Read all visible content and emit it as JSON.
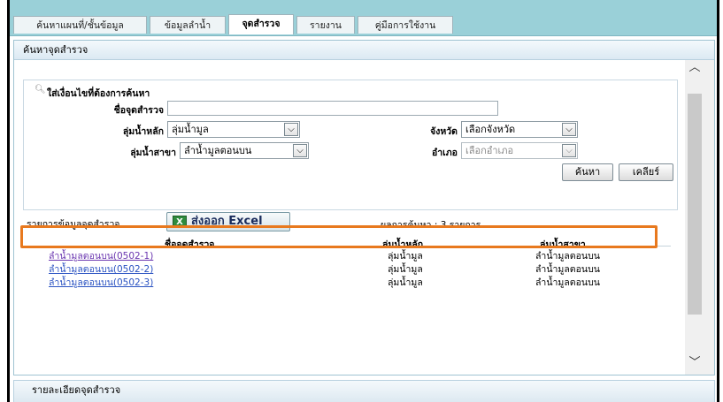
{
  "tabs": [
    {
      "label": "ค้นหาแผนที่/ชั้นข้อมูล"
    },
    {
      "label": "ข้อมูลลำน้ำ"
    },
    {
      "label": "จุดสำรวจ"
    },
    {
      "label": "รายงาน"
    },
    {
      "label": "คู่มือการใช้งาน"
    }
  ],
  "panel": {
    "title": "ค้นหาจุดสำรวจ"
  },
  "search": {
    "header": "ใส่เงื่อนไขที่ต้องการค้นหา",
    "station_name_label": "ชื่อจุดสำรวจ",
    "station_name_value": "",
    "main_basin_label": "ลุ่มน้ำหลัก",
    "main_basin_value": "ลุ่มน้ำมูล",
    "province_label": "จังหวัด",
    "province_value": "เลือกจังหวัด",
    "sub_basin_label": "ลุ่มน้ำสาขา",
    "sub_basin_value": "ลำน้ำมูลตอนบน",
    "district_label": "อำเภอ",
    "district_value": "เลือกอำเภอ",
    "search_button": "ค้นหา",
    "clear_button": "เคลียร์"
  },
  "results": {
    "list_label": "รายการข้อมูลจุดสำรวจ",
    "export_button": "ส่งออก Excel",
    "count_text": "ผลการค้นหา : 3 รายการ",
    "columns": [
      "ชื่อจุดสำรวจ",
      "ลุ่มน้ำหลัก",
      "ลุ่มน้ำสาขา"
    ],
    "rows": [
      {
        "name": "ลำน้ำมูลตอนบน(0502-1)",
        "main_basin": "ลุ่มน้ำมูล",
        "sub_basin": "ลำน้ำมูลตอนบน"
      },
      {
        "name": "ลำน้ำมูลตอนบน(0502-2)",
        "main_basin": "ลุ่มน้ำมูล",
        "sub_basin": "ลำน้ำมูลตอนบน"
      },
      {
        "name": "ลำน้ำมูลตอนบน(0502-3)",
        "main_basin": "ลุ่มน้ำมูล",
        "sub_basin": "ลำน้ำมูลตอนบน"
      }
    ]
  },
  "footer": {
    "title": "รายละเอียดจุดสำรวจ"
  },
  "colors": {
    "tab_bar": "#9ad0d8",
    "link": "#2b53c2",
    "visited_link": "#6a36b0",
    "highlight": "#e8791e"
  },
  "icons": {
    "search": "search-icon",
    "excel": "excel-icon",
    "dropdown": "chevron-down-icon",
    "scroll_up": "chevron-up-icon",
    "scroll_down": "chevron-down-icon"
  }
}
